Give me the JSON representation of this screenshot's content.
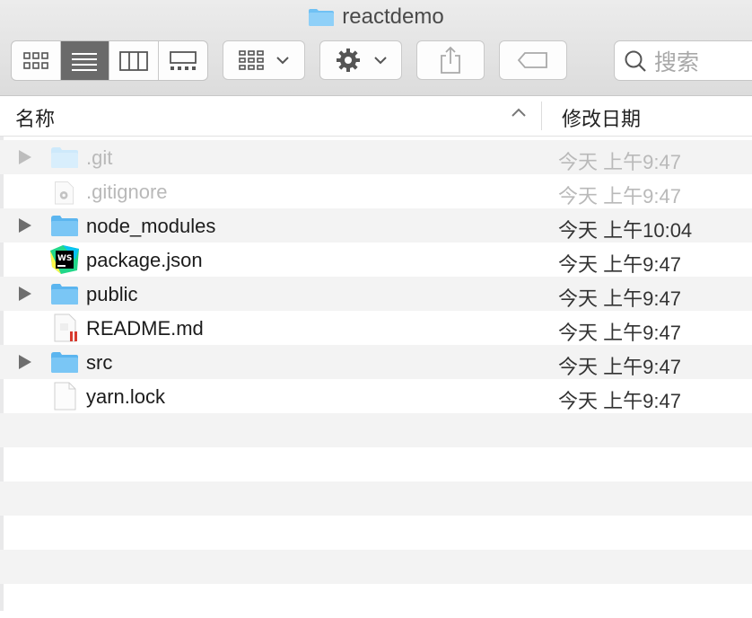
{
  "window": {
    "title": "reactdemo"
  },
  "toolbar": {
    "view_buttons": [
      "icon-view",
      "list-view",
      "column-view",
      "gallery-view"
    ],
    "active_view": "list-view",
    "search_placeholder": "搜索"
  },
  "columns": {
    "name": "名称",
    "date_modified": "修改日期"
  },
  "files": [
    {
      "name": ".git",
      "date": "今天 上午9:47",
      "kind": "folder",
      "expandable": true,
      "hidden": true
    },
    {
      "name": ".gitignore",
      "date": "今天 上午9:47",
      "kind": "gear-file",
      "expandable": false,
      "hidden": true
    },
    {
      "name": "node_modules",
      "date": "今天 上午10:04",
      "kind": "folder",
      "expandable": true,
      "hidden": false
    },
    {
      "name": "package.json",
      "date": "今天 上午9:47",
      "kind": "webstorm-file",
      "expandable": false,
      "hidden": false
    },
    {
      "name": "public",
      "date": "今天 上午9:47",
      "kind": "folder",
      "expandable": true,
      "hidden": false
    },
    {
      "name": "README.md",
      "date": "今天 上午9:47",
      "kind": "markdown-file",
      "expandable": false,
      "hidden": false
    },
    {
      "name": "src",
      "date": "今天 上午9:47",
      "kind": "folder",
      "expandable": true,
      "hidden": false
    },
    {
      "name": "yarn.lock",
      "date": "今天 上午9:47",
      "kind": "blank-file",
      "expandable": false,
      "hidden": false
    }
  ],
  "colors": {
    "folder": "#6fc1f4",
    "active_segment": "#6a6a6a",
    "alt_row": "#f3f3f3"
  }
}
